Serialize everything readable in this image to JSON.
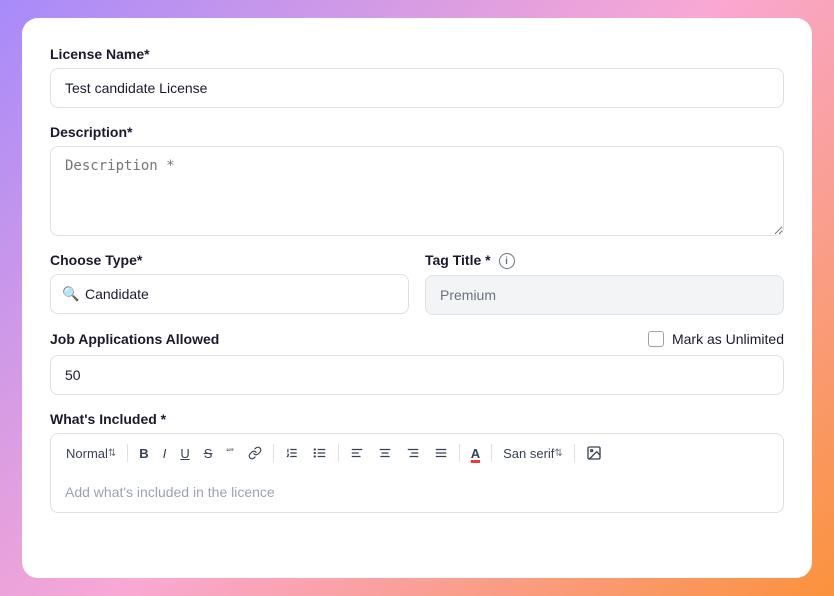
{
  "form": {
    "license_name_label": "License Name*",
    "license_name_value": "Test candidate License",
    "description_label": "Description*",
    "description_placeholder": "Description *",
    "choose_type_label": "Choose Type*",
    "choose_type_value": "Candidate",
    "tag_title_label": "Tag Title *",
    "tag_title_value": "Premium",
    "job_applications_label": "Job Applications Allowed",
    "mark_unlimited_label": "Mark as Unlimited",
    "job_applications_value": "50",
    "whats_included_label": "What's Included *",
    "whats_included_placeholder": "Add what's included in the licence",
    "toolbar": {
      "normal_label": "Normal",
      "bold_label": "B",
      "italic_label": "I",
      "underline_label": "U",
      "strikethrough_label": "S",
      "quote_label": "99",
      "link_label": "🔗",
      "list_ordered_label": "≡",
      "list_unordered_label": "≡",
      "align_left_label": "≡",
      "align_center_label": "≡",
      "font_color_label": "A",
      "font_family_label": "San serif",
      "image_label": "🖼"
    }
  }
}
